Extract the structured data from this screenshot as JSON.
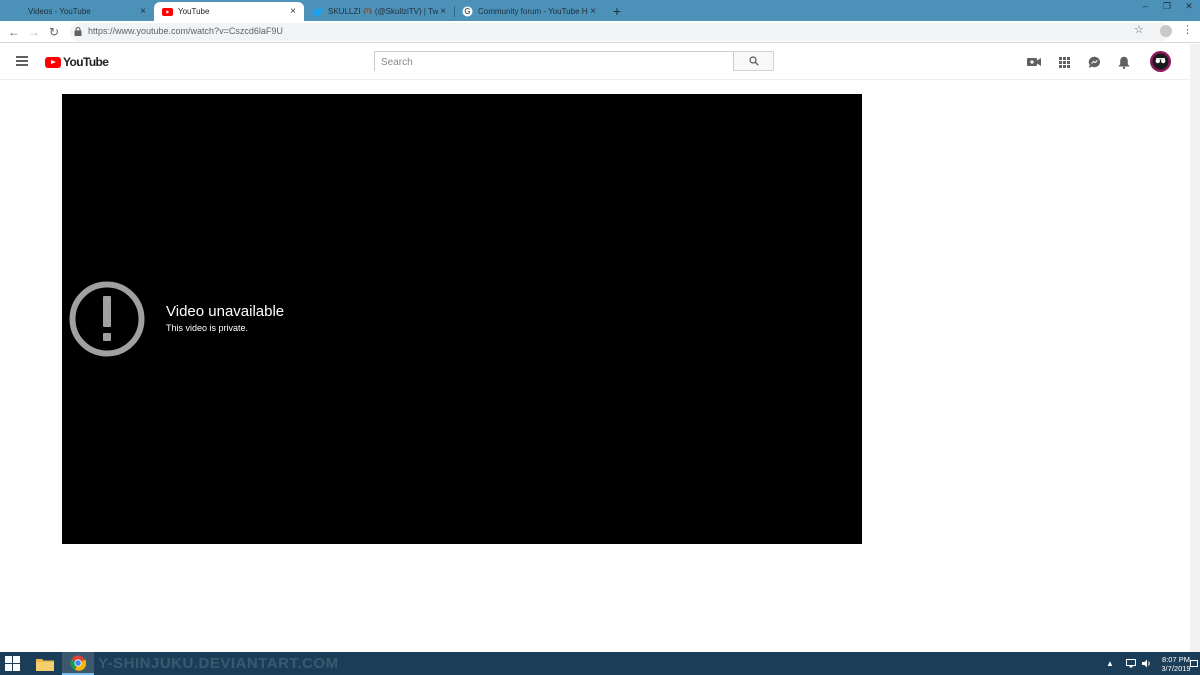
{
  "browser": {
    "tabs": [
      {
        "title": "Videos - YouTube",
        "favicon": "youtube-icon",
        "active": false
      },
      {
        "title": "YouTube",
        "favicon": "youtube-icon",
        "active": true
      },
      {
        "title": "SKULLZI 🎮 (@SkullziTV) | Twitter",
        "favicon": "twitter-icon",
        "active": false
      },
      {
        "title": "Community forum - YouTube He",
        "favicon": "google-icon",
        "active": false
      }
    ],
    "url": "https://www.youtube.com/watch?v=Cszcd6laF9U"
  },
  "youtube": {
    "logo_text": "YouTube",
    "search_placeholder": "Search",
    "header_icons": [
      "create-video-icon",
      "apps-grid-icon",
      "messages-icon",
      "notifications-bell-icon",
      "avatar"
    ]
  },
  "player": {
    "error_title": "Video unavailable",
    "error_subtitle": "This video is private."
  },
  "taskbar": {
    "watermark": "Y-SHINJUKU.DEVIANTART.COM",
    "time": "8:07 PM",
    "date": "3/7/2019"
  },
  "colors": {
    "tabstrip": "#4c91b7",
    "youtube_red": "#ff0000",
    "taskbar": "#1c3d57",
    "player_bg": "#000000"
  }
}
